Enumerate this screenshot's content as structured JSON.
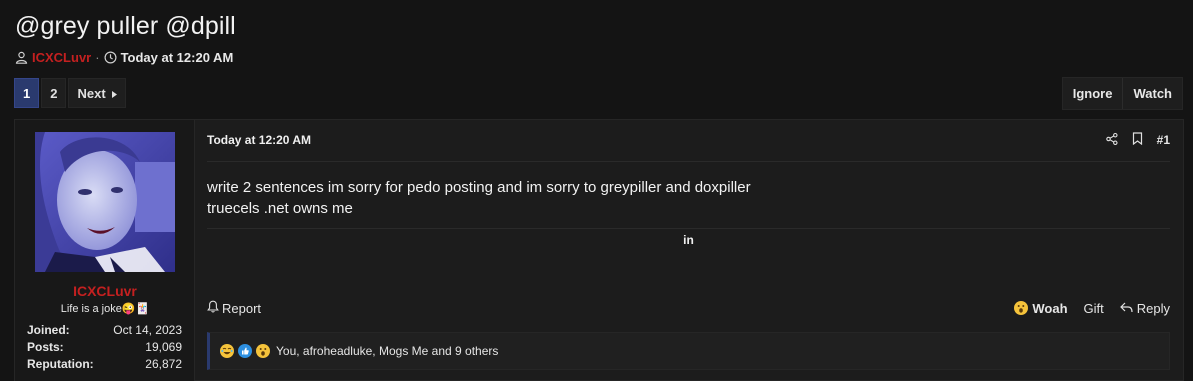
{
  "thread": {
    "title": "@grey puller @dpill",
    "author": "ICXCLuvr",
    "separator": "·",
    "time": "Today at 12:20 AM"
  },
  "pagination": {
    "pages": [
      "1",
      "2"
    ],
    "current": "1",
    "next_label": "Next"
  },
  "thread_actions": {
    "ignore_label": "Ignore",
    "watch_label": "Watch"
  },
  "post": {
    "user": {
      "username": "ICXCLuvr",
      "title": "Life is a joke😜🃏",
      "stats": [
        {
          "label": "Joined:",
          "value": "Oct 14, 2023"
        },
        {
          "label": "Posts:",
          "value": "19,069"
        },
        {
          "label": "Reputation:",
          "value": "26,872"
        }
      ]
    },
    "date": "Today at 12:20 AM",
    "number": "#1",
    "body_lines": [
      "write 2 sentences im sorry for pedo posting and im sorry to greypiller and doxpiller",
      "truecels .net owns me"
    ],
    "signature": "in",
    "report_label": "Report",
    "woah_label": "Woah",
    "gift_label": "Gift",
    "reply_label": "Reply",
    "reactions_text": "You, afroheadluke, Mogs Me and 9 others"
  },
  "icons": {
    "author": "user-icon",
    "time": "clock-icon",
    "share": "share-icon",
    "bookmark": "bookmark-icon",
    "report": "bell-icon",
    "reply": "reply-arrow-icon"
  },
  "colors": {
    "background": "#141414",
    "username": "#c42020",
    "active_page": "#2a3a6e",
    "accent": "#2d8fe0"
  }
}
